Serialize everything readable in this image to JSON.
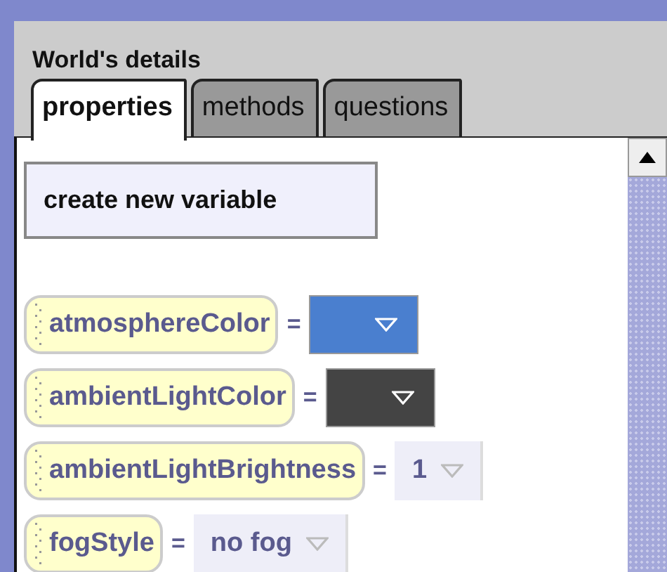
{
  "panel": {
    "title": "World's details"
  },
  "tabs": [
    {
      "label": "properties",
      "selected": true
    },
    {
      "label": "methods",
      "selected": false
    },
    {
      "label": "questions",
      "selected": false
    }
  ],
  "create_button": "create new variable",
  "properties": [
    {
      "name": "atmosphereColor",
      "equals": "=",
      "kind": "color",
      "color": "#4a7fcf"
    },
    {
      "name": "ambientLightColor",
      "equals": "=",
      "kind": "color",
      "color": "#444444"
    },
    {
      "name": "ambientLightBrightness",
      "equals": "=",
      "kind": "value",
      "value": "1"
    },
    {
      "name": "fogStyle",
      "equals": "=",
      "kind": "value",
      "value": "no fog"
    }
  ]
}
